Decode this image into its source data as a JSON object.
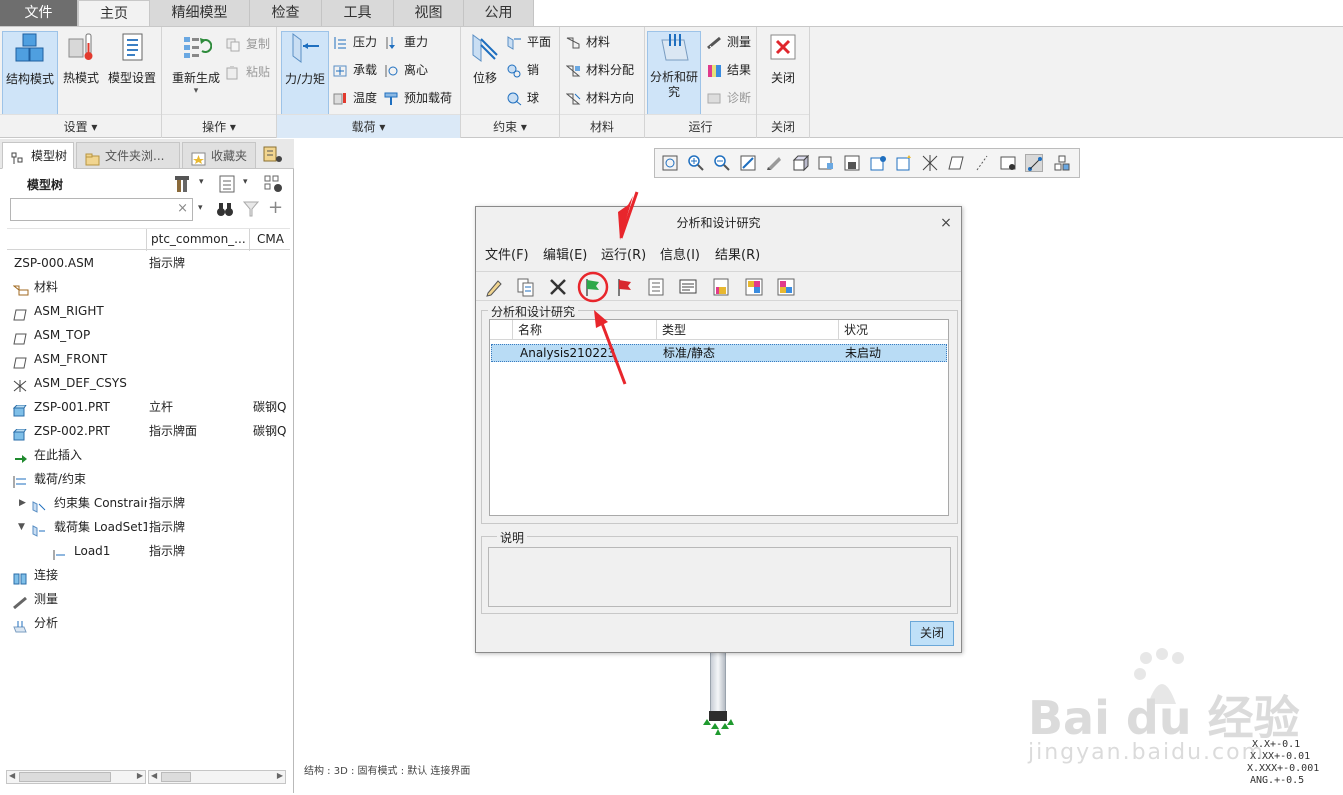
{
  "tabs": [
    "文件",
    "主页",
    "精细模型",
    "检查",
    "工具",
    "视图",
    "公用"
  ],
  "ribbon": {
    "setup": {
      "label": "设置",
      "struct_mode": "结构模式",
      "thermal_mode": "热模式",
      "model_setup": "模型设置"
    },
    "operations": {
      "label": "操作",
      "regenerate": "重新生成",
      "copy": "复制",
      "paste": "粘贴"
    },
    "loads": {
      "label": "载荷",
      "force_moment": "力/力矩",
      "pressure": "压力",
      "bearing": "承载",
      "temperature": "温度",
      "gravity": "重力",
      "centrifugal": "离心",
      "preload": "预加载荷"
    },
    "constraints": {
      "label": "约束",
      "displacement": "位移",
      "plane": "平面",
      "pin": "销",
      "ball": "球"
    },
    "materials": {
      "label": "材料",
      "material": "材料",
      "material_assign": "材料分配",
      "material_direction": "材料方向"
    },
    "run": {
      "label": "运行",
      "analyses": "分析和研究",
      "measure": "测量",
      "results": "结果",
      "diagnostics": "诊断"
    },
    "close": {
      "label": "关闭",
      "button": "关闭"
    }
  },
  "left_panel": {
    "tabs": [
      "模型树",
      "文件夹浏...",
      "收藏夹"
    ],
    "tree_title": "模型树",
    "search_placeholder": "",
    "columns": [
      "",
      "ptc_common_...",
      "CMA"
    ],
    "rows": [
      {
        "name": "ZSP-000.ASM",
        "col2": "指示牌",
        "col3": ""
      },
      {
        "name": "材料",
        "col2": "",
        "col3": ""
      },
      {
        "name": "ASM_RIGHT",
        "col2": "",
        "col3": ""
      },
      {
        "name": "ASM_TOP",
        "col2": "",
        "col3": ""
      },
      {
        "name": "ASM_FRONT",
        "col2": "",
        "col3": ""
      },
      {
        "name": "ASM_DEF_CSYS",
        "col2": "",
        "col3": ""
      },
      {
        "name": "ZSP-001.PRT",
        "col2": "立杆",
        "col3": "碳钢Q"
      },
      {
        "name": "ZSP-002.PRT",
        "col2": "指示牌面",
        "col3": "碳钢Q"
      },
      {
        "name": "在此插入",
        "col2": "",
        "col3": ""
      },
      {
        "name": "载荷/约束",
        "col2": "",
        "col3": ""
      },
      {
        "name": "约束集 Constrair",
        "col2": "指示牌",
        "col3": ""
      },
      {
        "name": "载荷集 LoadSet1",
        "col2": "指示牌",
        "col3": ""
      },
      {
        "name": "Load1",
        "col2": "指示牌",
        "col3": ""
      },
      {
        "name": "连接",
        "col2": "",
        "col3": ""
      },
      {
        "name": "测量",
        "col2": "",
        "col3": ""
      },
      {
        "name": "分析",
        "col2": "",
        "col3": ""
      }
    ]
  },
  "dialog": {
    "title": "分析和设计研究",
    "close_x": "×",
    "menu": [
      "文件(F)",
      "编辑(E)",
      "运行(R)",
      "信息(I)",
      "结果(R)"
    ],
    "group_label": "分析和设计研究",
    "columns": [
      "名称",
      "类型",
      "状况"
    ],
    "rows": [
      {
        "name": "Analysis210223",
        "type": "标准/静态",
        "status": "未启动"
      }
    ],
    "desc_label": "说明",
    "close_button": "关闭"
  },
  "statusbar": "结构 : 3D : 固有模式 : 默认 连接界面",
  "tolerances": [
    "X.X+-0.1",
    "X.XX+-0.01",
    "X.XXX+-0.001",
    "ANG.+-0.5"
  ],
  "watermark": {
    "brand": "Bai du 经验",
    "url": "jingyan.baidu.com"
  },
  "colors": {
    "ribbon_bg": "#f2f2f2",
    "selected_row": "#b9dcf5",
    "annotation_red": "#e8262c",
    "run_flag_green": "#2ea84a"
  }
}
